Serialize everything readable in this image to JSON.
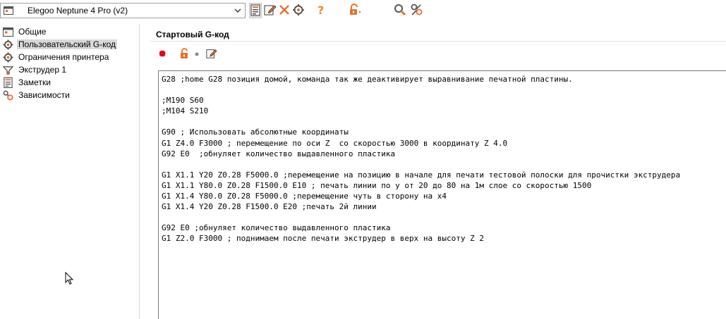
{
  "toolbar": {
    "printer_preset": "Elegoo Neptune 4 Pro (v2)",
    "icons": [
      "save-preset-icon",
      "edit-preset-icon",
      "delete-preset-icon",
      "compare-presets-icon",
      "help-icon",
      "unlock-icon",
      "search-icon",
      "settings-tools-icon"
    ]
  },
  "sidebar": {
    "items": [
      {
        "label": "Общие",
        "icon": "printer-general-icon"
      },
      {
        "label": "Пользовательский G-код",
        "icon": "gcode-gear-icon",
        "selected": true
      },
      {
        "label": "Ограничения принтера",
        "icon": "gear-icon"
      },
      {
        "label": "Экструдер 1",
        "icon": "extruder-icon"
      },
      {
        "label": "Заметки",
        "icon": "notes-icon"
      },
      {
        "label": "Зависимости",
        "icon": "dependencies-icon"
      }
    ]
  },
  "main": {
    "section_title": "Стартовый G-код",
    "editor_lines": [
      "G28 ;home G28 позиция домой, команда так же деактивирует выравнивание печатной пластины.",
      "",
      ";M190 S60",
      ";M104 S210",
      "",
      "G90 ; Использовать абсолютные координаты",
      "G1 Z4.0 F3000 ; перемещение по оси Z  со скоростью 3000 в координату Z 4.0",
      "G92 E0  ;обнуляет количество выдавленного пластика",
      "",
      "G1 X1.1 Y20 Z0.28 F5000.0 ;перемещение на позицию в начале для печати тестовой полоски для прочистки экструдера",
      "G1 X1.1 Y80.0 Z0.28 F1500.0 E10 ; печать линии по y от 20 до 80 на 1м слое со скоростью 1500",
      "G1 X1.4 Y80.0 Z0.28 F5000.0 ;перемещение чуть в сторону на x4",
      "G1 X1.4 Y20 Z0.28 F1500.0 E20 ;печать 2й линии",
      "",
      "G92 E0 ;обнуляет количество выдавленного пластика",
      "G1 Z2.0 F3000 ; поднимаем после печати экструдер в верх на высоту Z 2"
    ]
  },
  "colors": {
    "accent": "#e8702a",
    "help": "#f08a24",
    "record": "#e8001c",
    "selection": "#d9d9d9"
  }
}
